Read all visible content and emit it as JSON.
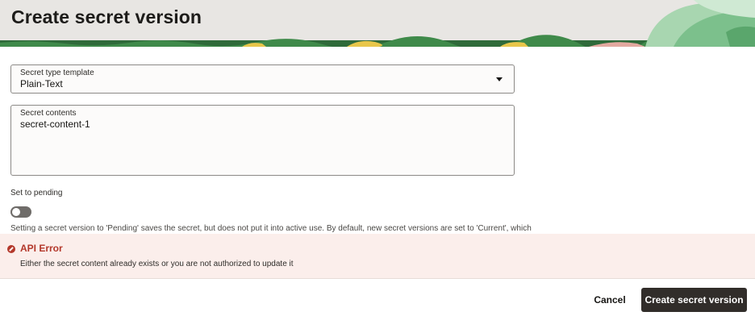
{
  "header": {
    "title": "Create secret version"
  },
  "form": {
    "secret_type": {
      "label": "Secret type template",
      "value": "Plain-Text"
    },
    "secret_contents": {
      "label": "Secret contents",
      "value": "secret-content-1"
    },
    "pending": {
      "label": "Set to pending",
      "enabled": false,
      "helper": "Setting a secret version to 'Pending' saves the secret, but does not put it into active use. By default, new secret versions are set to 'Current', which"
    }
  },
  "error": {
    "title": "API Error",
    "message": "Either the secret content already exists or you are not authorized to update it"
  },
  "footer": {
    "cancel_label": "Cancel",
    "submit_label": "Create secret version"
  },
  "colors": {
    "header_bg": "#e8e6e3",
    "error_red": "#b3372a",
    "error_bg": "#fbeeeb",
    "primary_button": "#312d2a"
  },
  "icons": {
    "error": "error-circle-icon",
    "select": "chevron-down-icon"
  }
}
